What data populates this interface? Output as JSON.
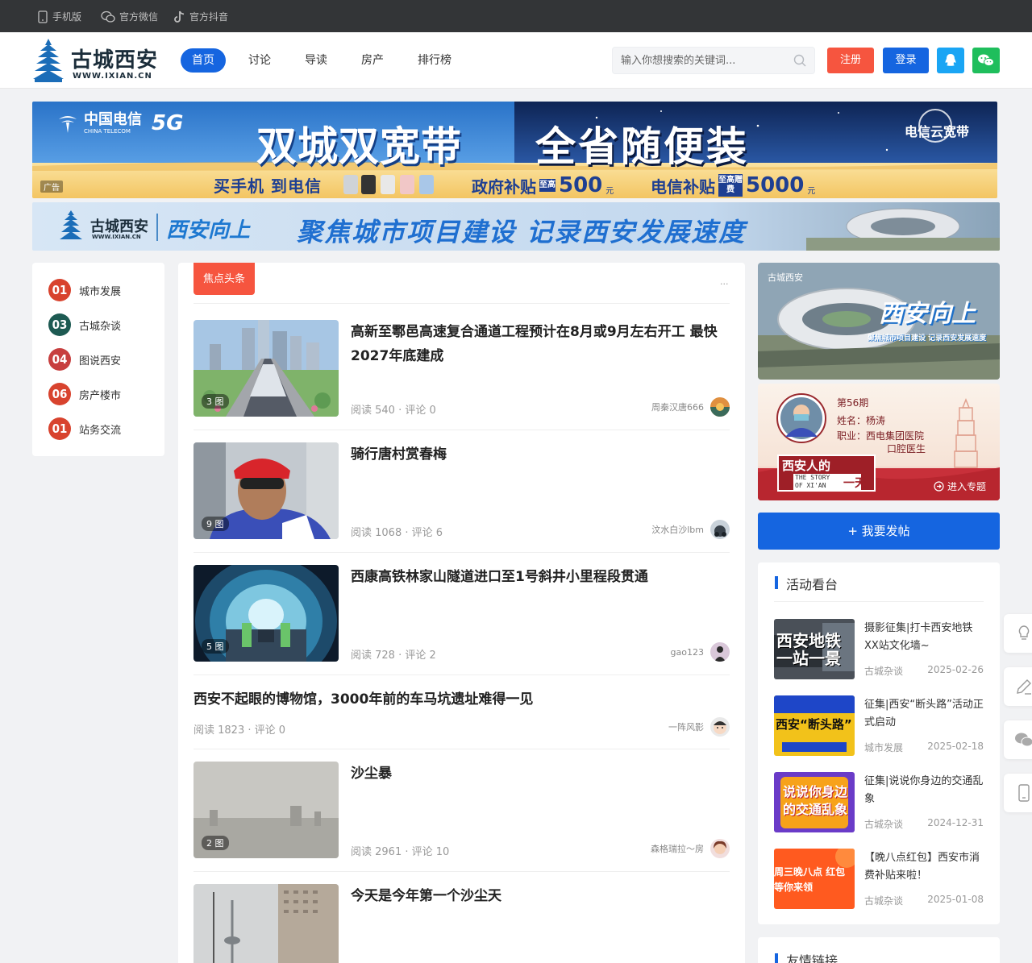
{
  "topbar": {
    "mobile": "手机版",
    "wechat": "官方微信",
    "douyin": "官方抖音"
  },
  "logo": {
    "name": "古城西安",
    "url": "WWW.IXIAN.CN"
  },
  "nav": [
    "首页",
    "讨论",
    "导读",
    "房产",
    "排行榜"
  ],
  "search": {
    "placeholder": "输入你想搜索的关键词..."
  },
  "buttons": {
    "register": "注册",
    "login": "登录"
  },
  "colors": {
    "primary": "#1565e0",
    "register": "#f6553f",
    "qq": "#1aa5f4",
    "wechat": "#1fbe5c",
    "tag": "#f6553f"
  },
  "banner1": {
    "telecom": "中国电信",
    "telecom_en": "CHINA TELECOM",
    "five_g": "5G",
    "slogan_left": "双城双宽带",
    "slogan_right": "全省随便装",
    "cloud": "电信云宽带",
    "ad": "广告",
    "buy": "买手机 到电信",
    "gov": "政府补贴",
    "gov_small": "至高",
    "gov_amount": "500",
    "unit": "元",
    "tel": "电信补贴",
    "tel_small": "至高赠费",
    "tel_amount": "5000"
  },
  "banner2": {
    "logo": "古城西安",
    "logo_url": "WWW.IXIAN.CN",
    "tag": "西安向上",
    "slogan": "聚焦城市项目建设 记录西安发展速度"
  },
  "sidebar": [
    {
      "rank": "01",
      "label": "城市发展",
      "color": "#d8432e"
    },
    {
      "rank": "03",
      "label": "古城杂谈",
      "color": "#1d5a52"
    },
    {
      "rank": "04",
      "label": "图说西安",
      "color": "#c73f3f"
    },
    {
      "rank": "06",
      "label": "房产楼市",
      "color": "#d8432e"
    },
    {
      "rank": "01",
      "label": "站务交流",
      "color": "#d8432e"
    }
  ],
  "focus": {
    "tag": "焦点头条",
    "more": "..."
  },
  "articles": [
    {
      "title": "高新至鄠邑高速复合通道工程预计在8月或9月左右开工 最快2027年底建成",
      "reads": "阅读 540",
      "comments": "评论 0",
      "author": "周秦汉唐666",
      "pics": "3 图"
    },
    {
      "title": "骑行唐村赏春梅",
      "reads": "阅读 1068",
      "comments": "评论 6",
      "author": "汶水白沙lbm",
      "pics": "9 图"
    },
    {
      "title": "西康高铁林家山隧道进口至1号斜井小里程段贯通",
      "reads": "阅读 728",
      "comments": "评论 2",
      "author": "gao123",
      "pics": "5 图"
    },
    {
      "title": "西安不起眼的博物馆，3000年前的车马坑遗址难得一见",
      "reads": "阅读 1823",
      "comments": "评论 0",
      "author": "一阵风影"
    },
    {
      "title": "沙尘暴",
      "reads": "阅读 2961",
      "comments": "评论 10",
      "author": "森格瑞拉～房",
      "pics": "2 图"
    },
    {
      "title": "今天是今年第一个沙尘天"
    }
  ],
  "right": {
    "promo_title": "西安向上",
    "promo_sub": "聚焦城市项目建设 记录西安发展速度",
    "story": {
      "issue": "第56期",
      "name": "姓名：杨涛",
      "job1": "职业：西电集团医院",
      "job2": "口腔医生",
      "brand": "西安人的",
      "brand_en1": "THE STORY",
      "brand_en2": "OF XI'AN",
      "day": "一天",
      "enter": "进入专题"
    },
    "post_button": "+ 我要发帖",
    "activity_title": "活动看台",
    "activities": [
      {
        "title": "摄影征集|打卡西安地铁XX站文化墙~",
        "cat": "古城杂谈",
        "date": "2025-02-26",
        "img": "西安地铁一站一景"
      },
      {
        "title": "征集|西安“断头路”活动正式启动",
        "cat": "城市发展",
        "date": "2025-02-18",
        "img": "西安“断头路”"
      },
      {
        "title": "征集|说说你身边的交通乱象",
        "cat": "古城杂谈",
        "date": "2024-12-31",
        "img": "说说你身边的交通乱象"
      },
      {
        "title": "【晚八点红包】西安市消费补贴来啦！",
        "cat": "古城杂谈",
        "date": "2025-01-08",
        "img": "周三晚八点 红包等你来领"
      }
    ],
    "links_title": "友情链接"
  }
}
